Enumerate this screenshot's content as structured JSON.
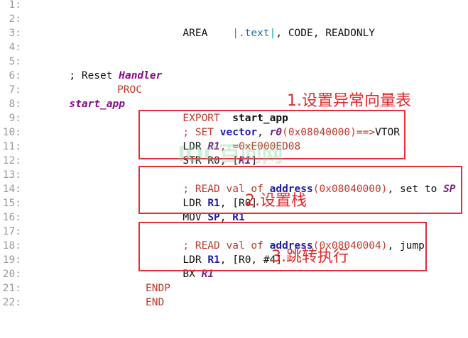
{
  "line_numbers": [
    "1:",
    "2:",
    "3:",
    "4:",
    "5:",
    "6:",
    "7:",
    "8:",
    "9:",
    "10:",
    "11:",
    "12:",
    "13:",
    "14:",
    "15:",
    "16:",
    "17:",
    "18:",
    "19:",
    "20:",
    "21:",
    "22:"
  ],
  "code": {
    "l2": {
      "area": "AREA",
      "bar1": "|",
      "text": ".text",
      "bar2": "|",
      "rest": ", CODE, READONLY"
    },
    "l5": {
      "comment": "; Reset ",
      "handler": "Handler"
    },
    "l7": {
      "label": "start_app",
      "proc": "PROC"
    },
    "l8": {
      "export": "EXPORT",
      "name": "start_app"
    },
    "l9": {
      "a": "; SET ",
      "vector": "vector",
      "comma": ", ",
      "r0": "r0",
      "rest": "(0x08040000)==>",
      "vtor": "VTOR"
    },
    "l10": {
      "ldr": "LDR ",
      "r1": "R1",
      "rest": ", =0xE000ED08"
    },
    "l11": {
      "str": "STR R0, [",
      "r1": "R1",
      "close": "]"
    },
    "l13": {
      "a": "; READ val of ",
      "address": "address",
      "num": "(0x08040000)",
      "b": ", set to ",
      "sp": "SP"
    },
    "l14": {
      "ldr": "LDR ",
      "r1": "R1",
      "rest": ", [R0]"
    },
    "l15": {
      "mov": "MOV ",
      "sp": "SP",
      "comma": ", ",
      "r1": "R1"
    },
    "l17": {
      "a": "; READ val of ",
      "address": "address",
      "num": "(0x08040004)",
      "b": ", jump"
    },
    "l18": {
      "ldr": "LDR ",
      "r1": "R1",
      "rest": ", [R0, #4]"
    },
    "l19": {
      "bx": "BX ",
      "r1": "R1"
    },
    "l21": {
      "endp": "ENDP"
    },
    "l22": {
      "end": "END"
    }
  },
  "annotations": {
    "a1": "1.设置异常向量表",
    "a2": "2.设置栈",
    "a3": "3.跳转执行"
  },
  "watermark": "IOC百问网",
  "colors": {
    "box": "#e0303a",
    "annotation": "#e02a2a"
  }
}
